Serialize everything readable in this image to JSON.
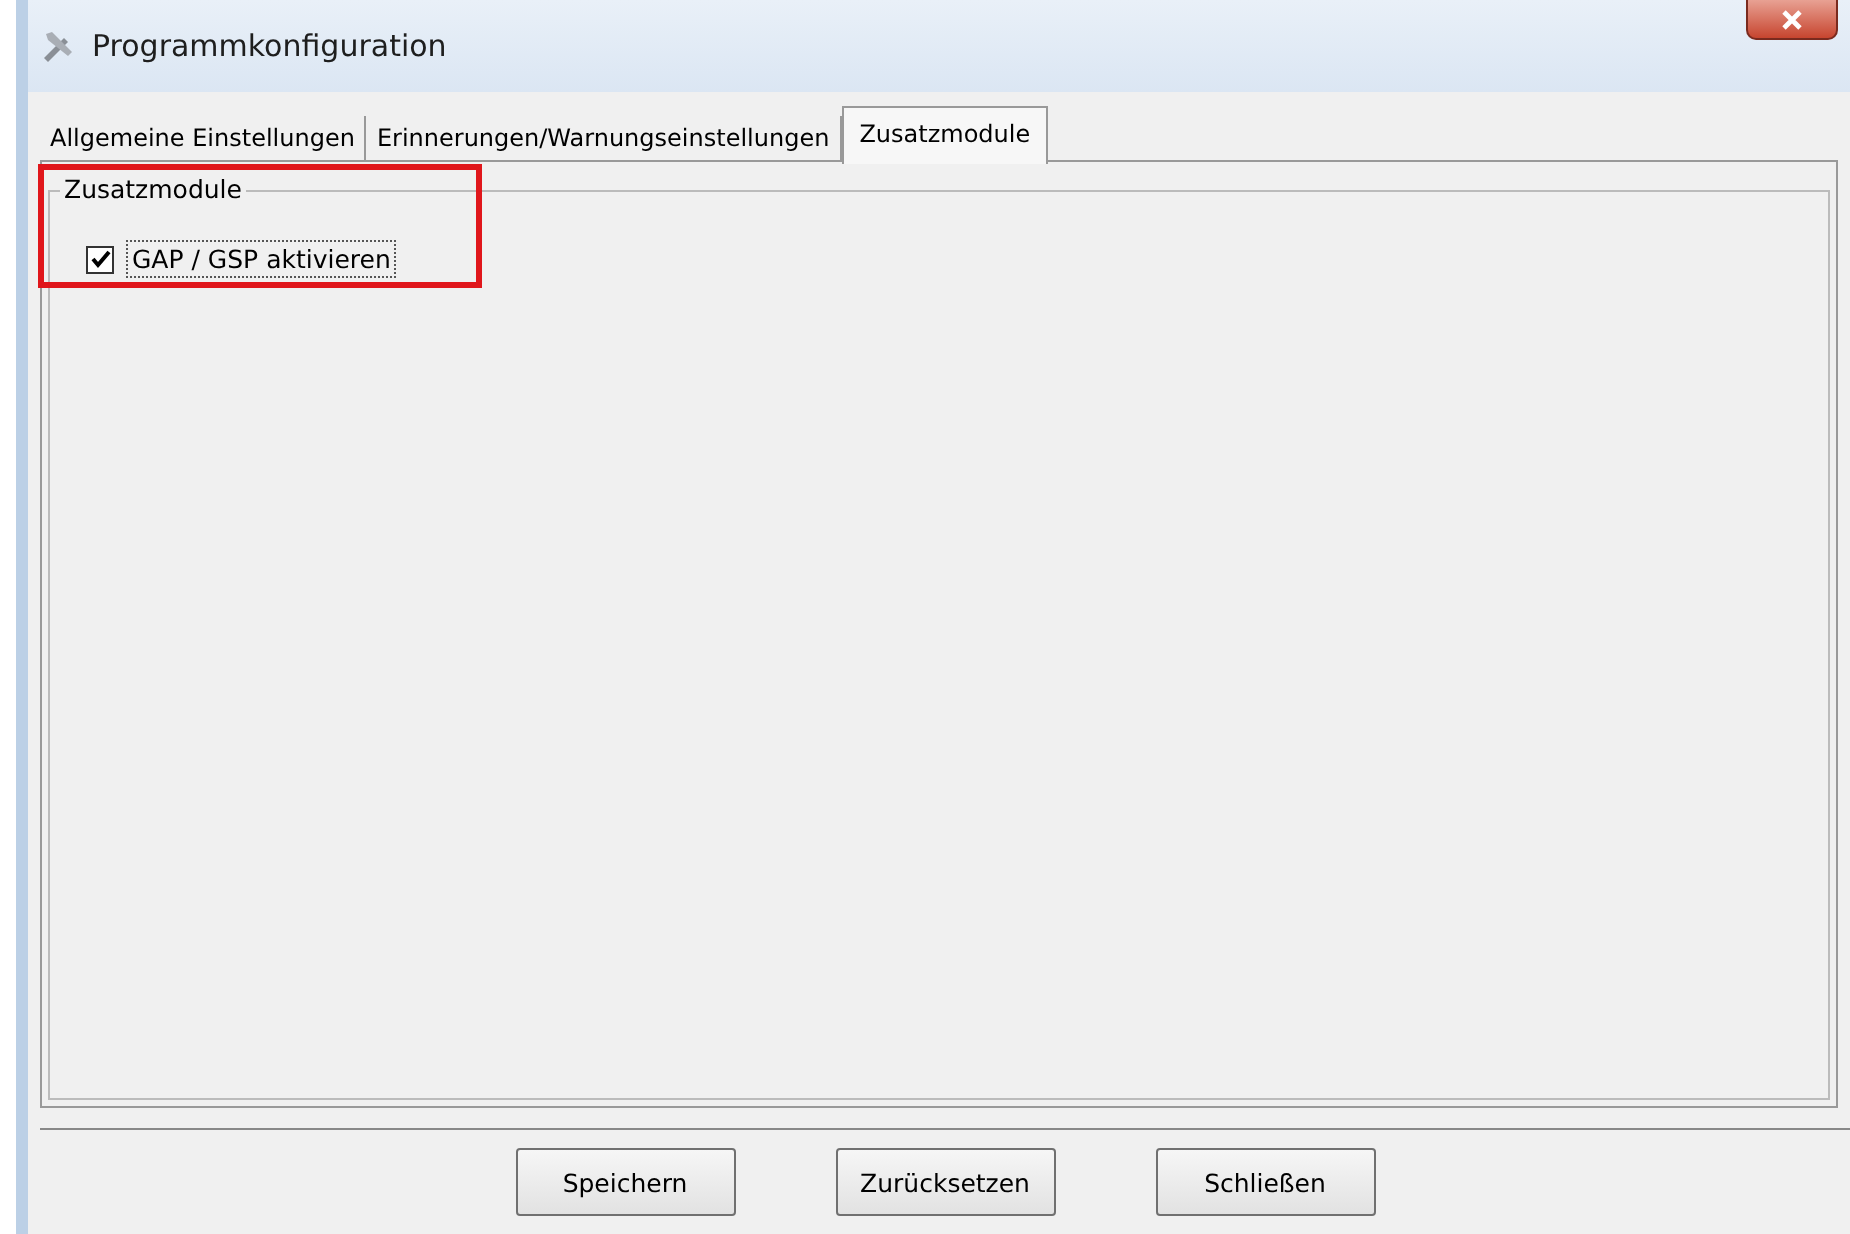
{
  "window": {
    "title": "Programmkonfiguration"
  },
  "tabs": [
    {
      "label": "Allgemeine Einstellungen",
      "selected": false
    },
    {
      "label": "Erinnerungen/Warnungseinstellungen",
      "selected": false
    },
    {
      "label": "Zusatzmodule",
      "selected": true
    }
  ],
  "group": {
    "title": "Zusatzmodule",
    "highlighted": true,
    "checkbox": {
      "label": "GAP / GSP aktivieren",
      "checked": true
    }
  },
  "buttons": [
    "Speichern",
    "Zurücksetzen",
    "Schließen"
  ]
}
